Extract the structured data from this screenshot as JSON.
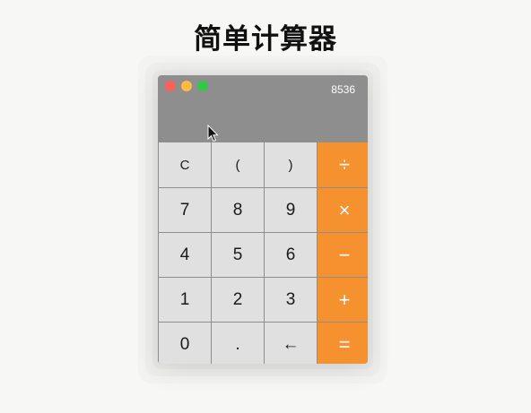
{
  "page": {
    "title": "简单计算器"
  },
  "window": {
    "display_value": "8536"
  },
  "keypad": {
    "rows": [
      [
        "C",
        "(",
        ")",
        "÷"
      ],
      [
        "7",
        "8",
        "9",
        "×"
      ],
      [
        "4",
        "5",
        "6",
        "−"
      ],
      [
        "1",
        "2",
        "3",
        "+"
      ],
      [
        "0",
        ".",
        "←",
        "="
      ]
    ]
  },
  "colors": {
    "background": "#f7f7f6",
    "window": "#8e8e8e",
    "key": "#e0e0e0",
    "operator_key": "#f5912e",
    "close_light": "#fc605c",
    "minimize_light": "#fdbc40",
    "maximize_light": "#34c84a"
  },
  "icons": {
    "cursor": "mouse-pointer-icon"
  }
}
